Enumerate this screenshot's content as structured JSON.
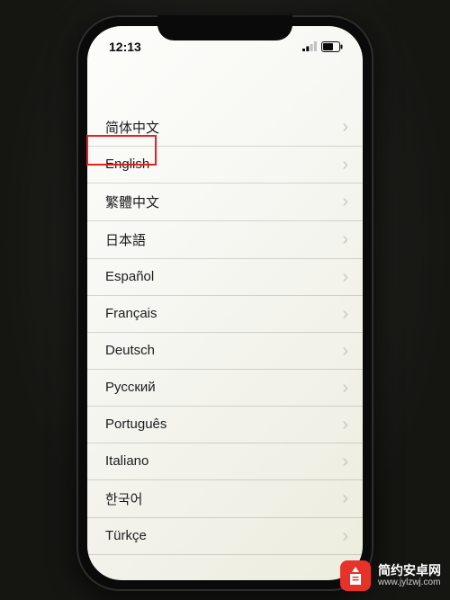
{
  "status": {
    "time": "12:13"
  },
  "languages": [
    {
      "label": "简体中文"
    },
    {
      "label": "English"
    },
    {
      "label": "繁體中文"
    },
    {
      "label": "日本語"
    },
    {
      "label": "Español"
    },
    {
      "label": "Français"
    },
    {
      "label": "Deutsch"
    },
    {
      "label": "Русский"
    },
    {
      "label": "Português"
    },
    {
      "label": "Italiano"
    },
    {
      "label": "한국어"
    },
    {
      "label": "Türkçe"
    }
  ],
  "highlight": {
    "index": 0
  },
  "watermark": {
    "title": "简约安卓网",
    "url": "www.jylzwj.com"
  }
}
